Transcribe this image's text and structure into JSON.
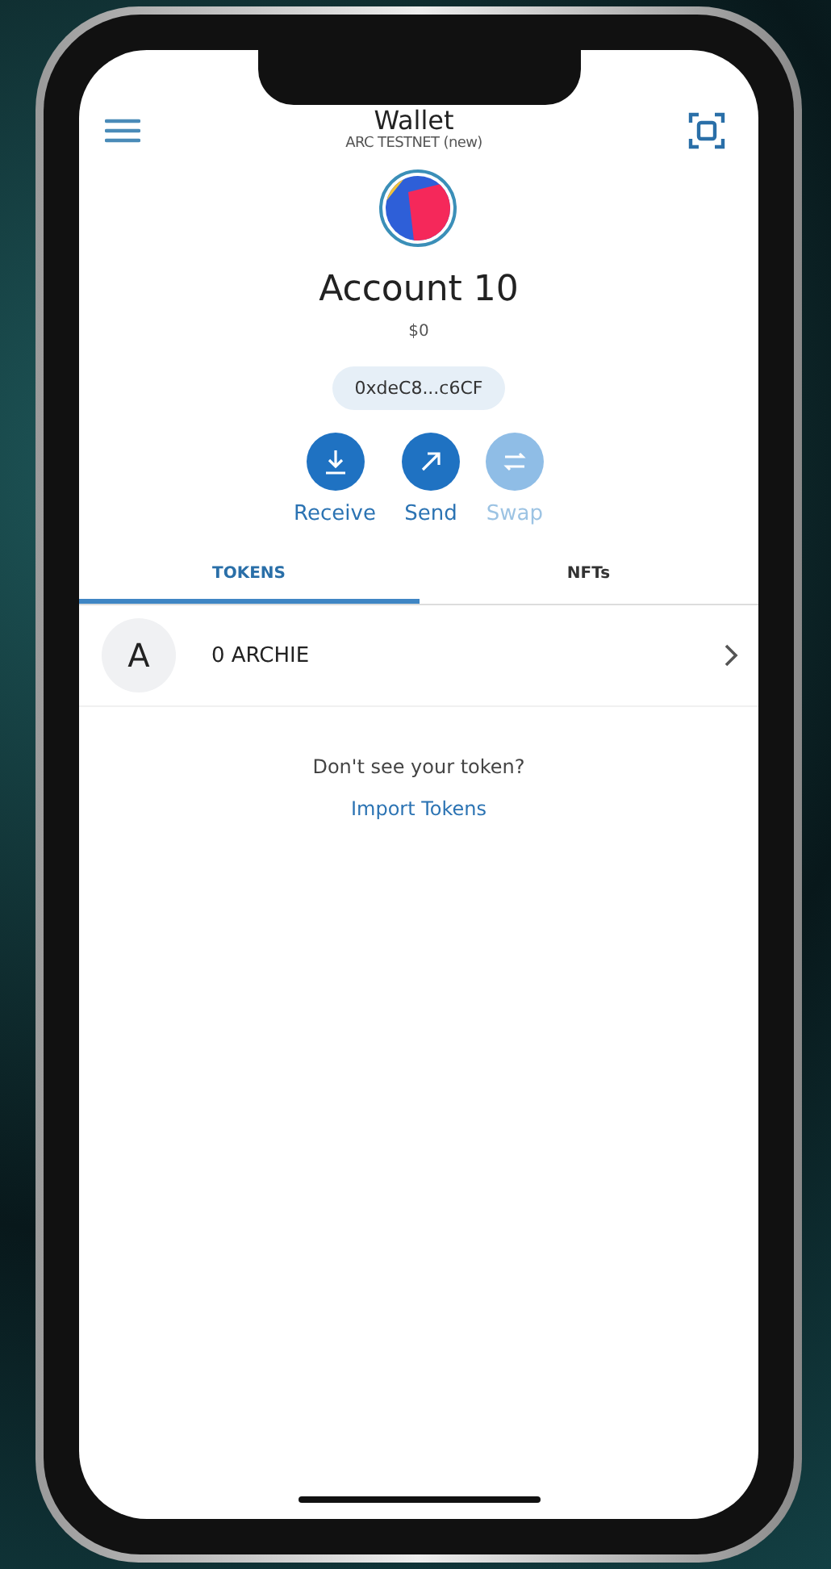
{
  "header": {
    "title": "Wallet",
    "network": "ARC TESTNET (new)"
  },
  "account": {
    "name": "Account 10",
    "balance": "$0",
    "address": "0xdeC8...c6CF"
  },
  "actions": [
    {
      "kind": "receive",
      "label": "Receive",
      "disabled": false
    },
    {
      "kind": "send",
      "label": "Send",
      "disabled": false
    },
    {
      "kind": "swap",
      "label": "Swap",
      "disabled": true
    }
  ],
  "tabs": [
    {
      "label": "TOKENS",
      "selected": true
    },
    {
      "label": "NFTs",
      "selected": false
    }
  ],
  "tokens": [
    {
      "letter": "A",
      "amount": "0 ARCHIE"
    }
  ],
  "footer": {
    "prompt": "Don't see your token?",
    "link": "Import Tokens"
  }
}
